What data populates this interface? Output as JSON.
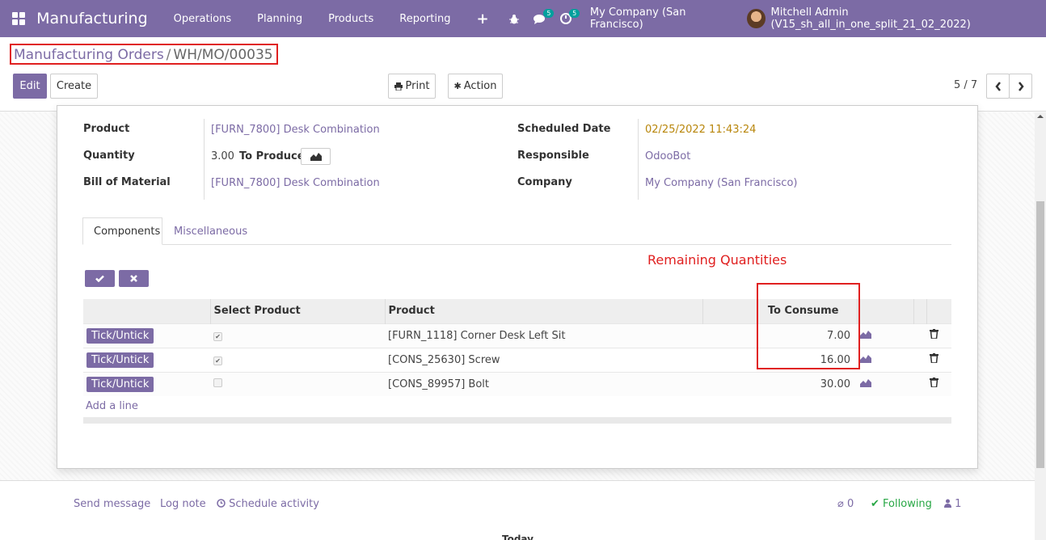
{
  "navbar": {
    "app_name": "Manufacturing",
    "menu": [
      "Operations",
      "Planning",
      "Products",
      "Reporting"
    ],
    "chat_badge": "5",
    "activity_badge": "5",
    "company": "My Company (San Francisco)",
    "user": "Mitchell Admin (V15_sh_all_in_one_split_21_02_2022)"
  },
  "breadcrumb": {
    "parent": "Manufacturing Orders",
    "separator": "/",
    "current": "WH/MO/00035"
  },
  "toolbar": {
    "edit_label": "Edit",
    "create_label": "Create",
    "print_label": "Print",
    "action_label": "Action",
    "pager": "5 / 7"
  },
  "form": {
    "product_label": "Product",
    "product_value": "[FURN_7800] Desk Combination",
    "quantity_label": "Quantity",
    "quantity_value": "3.00",
    "to_produce_label": "To Produce",
    "bom_label": "Bill of Material",
    "bom_value": "[FURN_7800] Desk Combination",
    "scheduled_label": "Scheduled Date",
    "scheduled_value": "02/25/2022 11:43:24",
    "responsible_label": "Responsible",
    "responsible_value": "OdooBot",
    "company_label": "Company",
    "company_value": "My Company (San Francisco)"
  },
  "tabs": [
    "Components",
    "Miscellaneous"
  ],
  "annotation": "Remaining Quantities",
  "table": {
    "headers": [
      "Select Product",
      "Product",
      "To Consume"
    ],
    "tick_label": "Tick/Untick",
    "rows": [
      {
        "selected": true,
        "product": "[FURN_1118] Corner Desk Left Sit",
        "to_consume": "7.00"
      },
      {
        "selected": true,
        "product": "[CONS_25630] Screw",
        "to_consume": "16.00"
      },
      {
        "selected": false,
        "product": "[CONS_89957] Bolt",
        "to_consume": "30.00"
      }
    ],
    "add_line": "Add a line"
  },
  "chatter": {
    "send_message": "Send message",
    "log_note": "Log note",
    "schedule_activity": "Schedule activity",
    "attachments": "0",
    "following": "Following",
    "followers": "1",
    "today": "Today"
  },
  "colors": {
    "brand": "#7c6ba5",
    "annotation": "#e02020",
    "date": "#b8860b",
    "following": "#28a745"
  }
}
